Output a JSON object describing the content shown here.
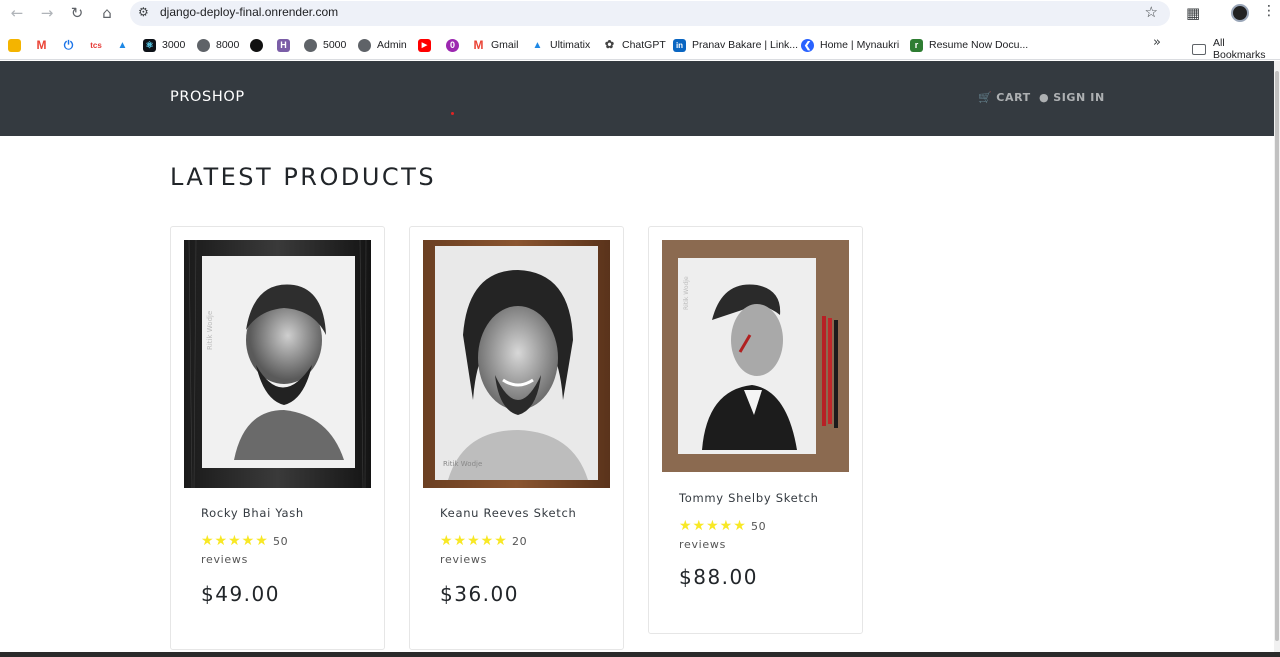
{
  "browser": {
    "url": "django-deploy-final.onrender.com",
    "bookmarks": [
      {
        "label": "",
        "color": "#f4b400",
        "icon": "keep-icon"
      },
      {
        "label": "",
        "color": "#ea4335",
        "icon": "gmail-icon"
      },
      {
        "label": "",
        "color": "#1a73e8",
        "icon": "power-icon"
      },
      {
        "label": "",
        "color": "#e53935",
        "icon": "tcs-icon"
      },
      {
        "label": "",
        "color": "#1e88e5",
        "icon": "tata-icon"
      },
      {
        "label": "3000",
        "color": "#0d1117",
        "icon": "react-icon"
      },
      {
        "label": "8000",
        "color": "#5f6368",
        "icon": "globe-icon"
      },
      {
        "label": "",
        "color": "#111111",
        "icon": "github-icon"
      },
      {
        "label": "",
        "color": "#7b5ea7",
        "icon": "heroku-icon"
      },
      {
        "label": "5000",
        "color": "#5f6368",
        "icon": "globe-icon"
      },
      {
        "label": "Admin",
        "color": "#5f6368",
        "icon": "globe-icon"
      },
      {
        "label": "",
        "color": "#ff0000",
        "icon": "youtube-icon"
      },
      {
        "label": "",
        "color": "#9c27b0",
        "icon": "onenote-icon"
      },
      {
        "label": "Gmail",
        "color": "#ea4335",
        "icon": "gmail-icon"
      },
      {
        "label": "Ultimatix",
        "color": "#1e88e5",
        "icon": "ultimatix-icon"
      },
      {
        "label": "ChatGPT",
        "color": "#444444",
        "icon": "chatgpt-icon"
      },
      {
        "label": "Pranav Bakare | Link...",
        "color": "#0a66c2",
        "icon": "linkedin-icon"
      },
      {
        "label": "Home | Mynaukri",
        "color": "#2962ff",
        "icon": "naukri-icon"
      },
      {
        "label": "Resume Now Docu...",
        "color": "#2e7d32",
        "icon": "resume-icon"
      }
    ],
    "all_bookmarks": "All Bookmarks"
  },
  "site": {
    "brand": "PROSHOP",
    "cart": "CART",
    "sign_in": "SIGN IN"
  },
  "page": {
    "title": "LATEST PRODUCTS"
  },
  "products": [
    {
      "name": "Rocky Bhai Yash",
      "stars": "★★★★★",
      "reviews_count": "50",
      "reviews_label": "reviews",
      "price": "$49.00",
      "image": "rocky-bhai-sketch"
    },
    {
      "name": "Keanu Reeves Sketch",
      "stars": "★★★★★",
      "reviews_count": "20",
      "reviews_label": "reviews",
      "price": "$36.00",
      "image": "keanu-reeves-sketch"
    },
    {
      "name": "Tommy Shelby Sketch",
      "stars": "★★★★★",
      "reviews_count": "50",
      "reviews_label": "reviews",
      "price": "$88.00",
      "image": "tommy-shelby-sketch"
    }
  ],
  "colors": {
    "header_bg": "#343a40",
    "star": "#f8e825"
  }
}
